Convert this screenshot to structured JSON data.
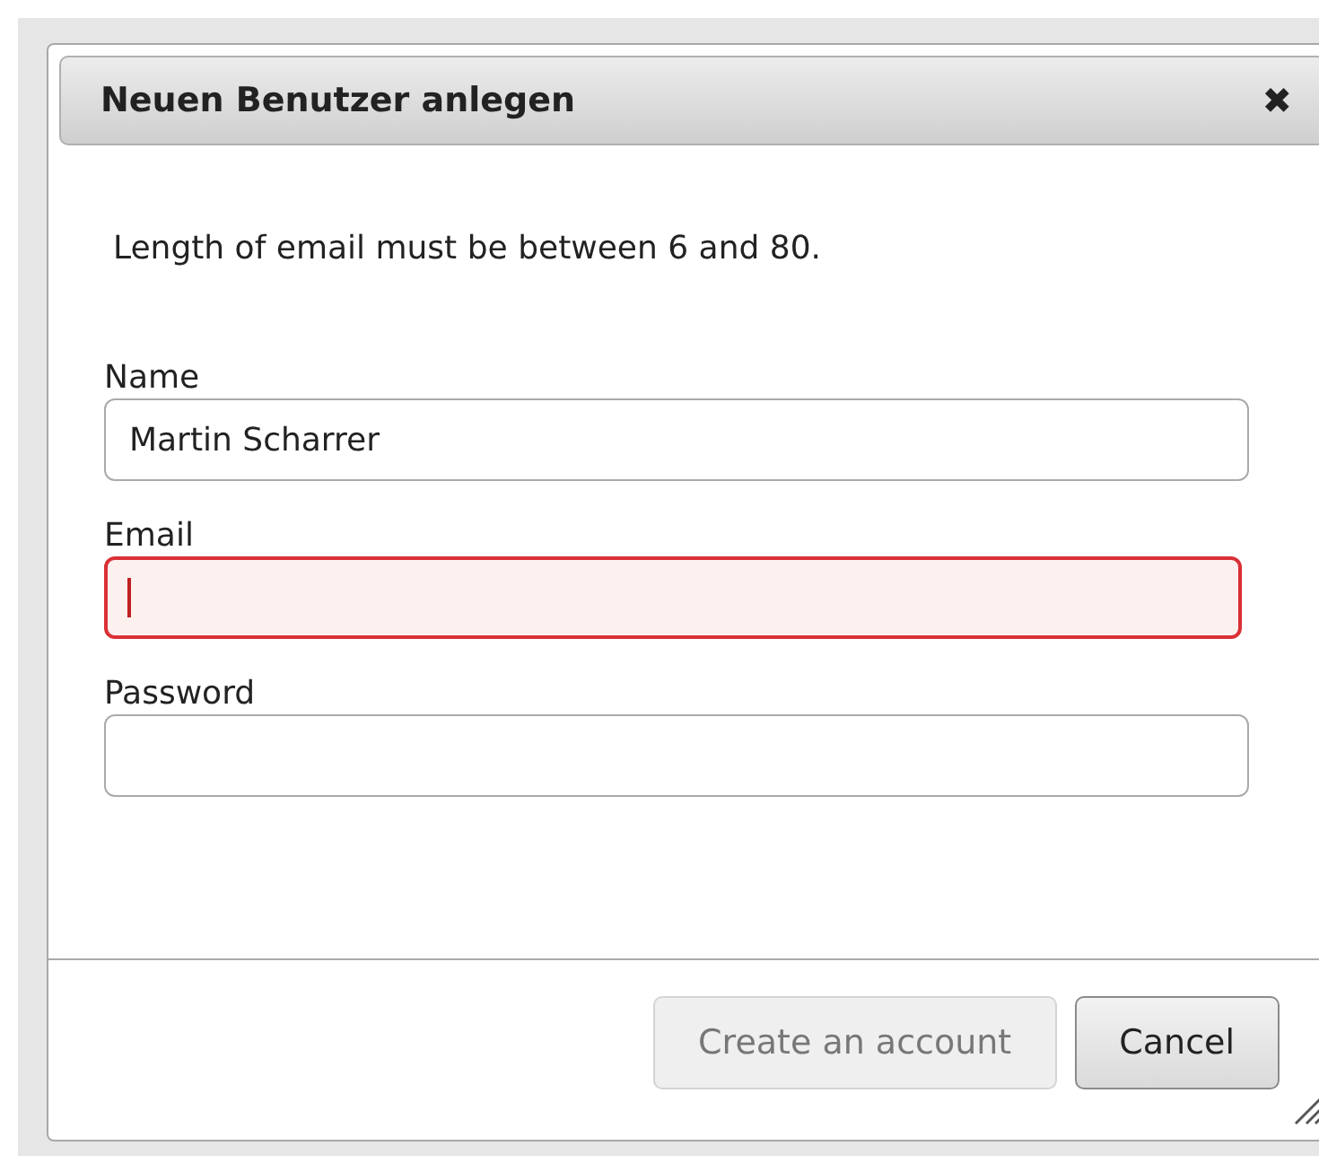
{
  "dialog": {
    "title": "Neuen Benutzer anlegen",
    "close": "✖"
  },
  "message": "Length of email must be between 6 and 80.",
  "fields": [
    {
      "label": "Name",
      "value": "Martin Scharrer",
      "invalid": false,
      "focused": false
    },
    {
      "label": "Email",
      "invalid": true,
      "focused": true
    },
    {
      "label": "Password",
      "invalid": false,
      "focused": false
    }
  ],
  "buttons": [
    {
      "label": "Create an account",
      "disabled": true
    },
    {
      "label": "Cancel",
      "disabled": false
    }
  ]
}
